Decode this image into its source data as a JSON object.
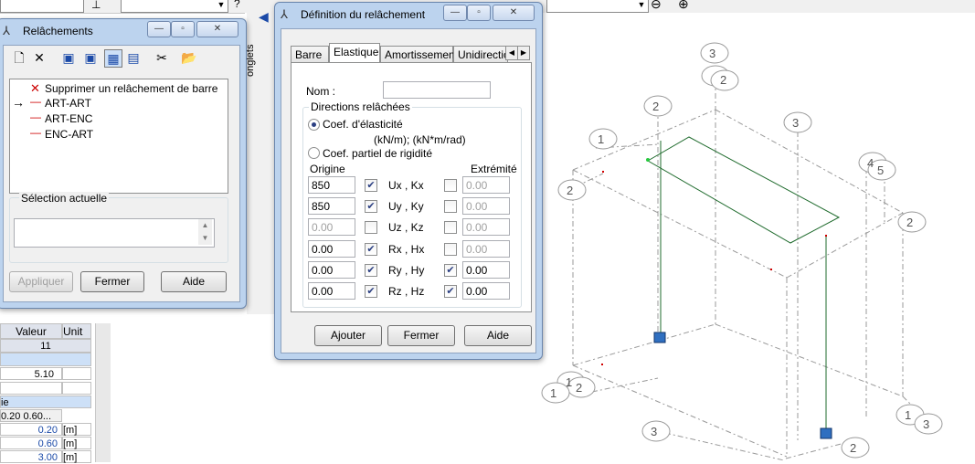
{
  "topbar": {
    "icon_q": "?"
  },
  "onglets_label": "onglets",
  "releasements_window": {
    "title": "Relâchements",
    "toolbar_icons": [
      "new-icon",
      "delete-icon",
      "view1-icon",
      "view2-icon",
      "view3-icon",
      "view4-icon",
      "cut-icon",
      "folder-icon"
    ],
    "list": [
      {
        "label": "Supprimer un relâchement de barre",
        "marker": "✕"
      },
      {
        "label": "ART-ART",
        "marker": "→"
      },
      {
        "label": "ART-ENC",
        "marker": "—"
      },
      {
        "label": "ENC-ART",
        "marker": "—"
      }
    ],
    "selection_label": "Sélection actuelle",
    "buttons": {
      "apply": "Appliquer",
      "close": "Fermer",
      "help": "Aide"
    }
  },
  "definition_window": {
    "title": "Définition du relâchement",
    "tabs": [
      "Barre",
      "Elastique",
      "Amortissement",
      "Unidirectio"
    ],
    "name_label": "Nom :",
    "directions_label": "Directions relâchées",
    "radio_elastic": "Coef. d'élasticité",
    "units": "(kN/m);  (kN*m/rad)",
    "radio_partial": "Coef. partiel de rigidité",
    "origin_label": "Origine",
    "end_label": "Extrémité",
    "rows": [
      {
        "origin": "850",
        "o_checked": true,
        "axis": "Ux  , Kx",
        "e_checked": false,
        "end": "0.00",
        "o_disabled": false,
        "e_disabled": true
      },
      {
        "origin": "850",
        "o_checked": true,
        "axis": "Uy  , Ky",
        "e_checked": false,
        "end": "0.00",
        "o_disabled": false,
        "e_disabled": true
      },
      {
        "origin": "0.00",
        "o_checked": false,
        "axis": "Uz  , Kz",
        "e_checked": false,
        "end": "0.00",
        "o_disabled": true,
        "e_disabled": true
      },
      {
        "origin": "0.00",
        "o_checked": true,
        "axis": "Rx  , Hx",
        "e_checked": false,
        "end": "0.00",
        "o_disabled": false,
        "e_disabled": true
      },
      {
        "origin": "0.00",
        "o_checked": true,
        "axis": "Ry  , Hy",
        "e_checked": true,
        "end": "0.00",
        "o_disabled": false,
        "e_disabled": false
      },
      {
        "origin": "0.00",
        "o_checked": true,
        "axis": "Rz  , Hz",
        "e_checked": true,
        "end": "0.00",
        "o_disabled": false,
        "e_disabled": false
      }
    ],
    "buttons": {
      "add": "Ajouter",
      "close": "Fermer",
      "help": "Aide"
    }
  },
  "prop_table": {
    "headers": [
      "Valeur",
      "Unit"
    ],
    "rows": [
      "11",
      "5.10",
      "ie",
      "0.20 0.60...",
      "0.20",
      "0.60",
      "3.00"
    ],
    "units": [
      "[m]",
      "[m]",
      "[m]"
    ]
  },
  "grid_labels": [
    "3",
    "2",
    "2",
    "3",
    "1",
    "2",
    "4",
    "5",
    "2",
    "1",
    "2",
    "1",
    "2",
    "3",
    "1",
    "3",
    "2"
  ]
}
